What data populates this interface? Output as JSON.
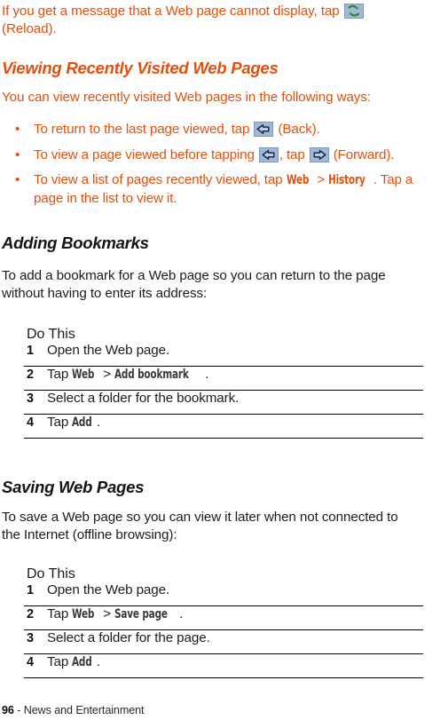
{
  "document": {
    "type": "user-guide-page",
    "text_color_accent": "#E0500F",
    "text_color_body": "#1c1c1c"
  },
  "intro": {
    "line1_before_icon": "If you get a message that a Web page cannot display, tap ",
    "icon": "reload-icon",
    "line2": "(Reload)."
  },
  "section_viewing": {
    "heading": "Viewing Recently Visited Web Pages",
    "lead": "You can view recently visited Web pages in the following ways:",
    "bullets": [
      {
        "bullet": "•",
        "part1": "To return to the last page viewed, tap ",
        "icon1": "back-arrow-icon",
        "part2": " (Back)."
      },
      {
        "bullet": "•",
        "part1": "To view a page viewed before tapping ",
        "icon1": "back-arrow-icon",
        "part2": ", tap ",
        "icon2": "forward-arrow-icon",
        "part3": " (Forward)."
      },
      {
        "bullet": "•",
        "part1": "To view a list of pages recently viewed, tap ",
        "term1": "Web",
        "separator": " > ",
        "term2": "History",
        "part2": ". Tap a",
        "part3": "page in the list to view it."
      }
    ]
  },
  "section_bookmarks": {
    "heading": "Adding Bookmarks",
    "lead_line1": "To add a bookmark for a Web page so you can return to the page",
    "lead_line2": "without having to enter its address:",
    "table": {
      "header": "Do This",
      "rows": [
        {
          "num": "1",
          "text": "Open the Web page."
        },
        {
          "num": "2",
          "prefix": "Tap ",
          "term1": "Web",
          "separator": " > ",
          "term2": "Add bookmark",
          "suffix": "."
        },
        {
          "num": "3",
          "text": "Select a folder for the bookmark."
        },
        {
          "num": "4",
          "prefix": "Tap ",
          "term1": "Add",
          "suffix": "."
        }
      ]
    }
  },
  "section_saving": {
    "heading": "Saving Web Pages",
    "lead_line1": "To save a Web page so you can view it later when not connected to",
    "lead_line2": "the Internet (offline browsing):",
    "table": {
      "header": "Do This",
      "rows": [
        {
          "num": "1",
          "text": "Open the Web page."
        },
        {
          "num": "2",
          "prefix": "Tap ",
          "term1": "Web",
          "separator": " > ",
          "term2": "Save page",
          "suffix": "."
        },
        {
          "num": "3",
          "text": "Select a folder for the page."
        },
        {
          "num": "4",
          "prefix": "Tap ",
          "term1": "Add",
          "suffix": "."
        }
      ]
    }
  },
  "footer": {
    "page_number": "96",
    "separator": " - ",
    "chapter": "News and Entertainment"
  }
}
